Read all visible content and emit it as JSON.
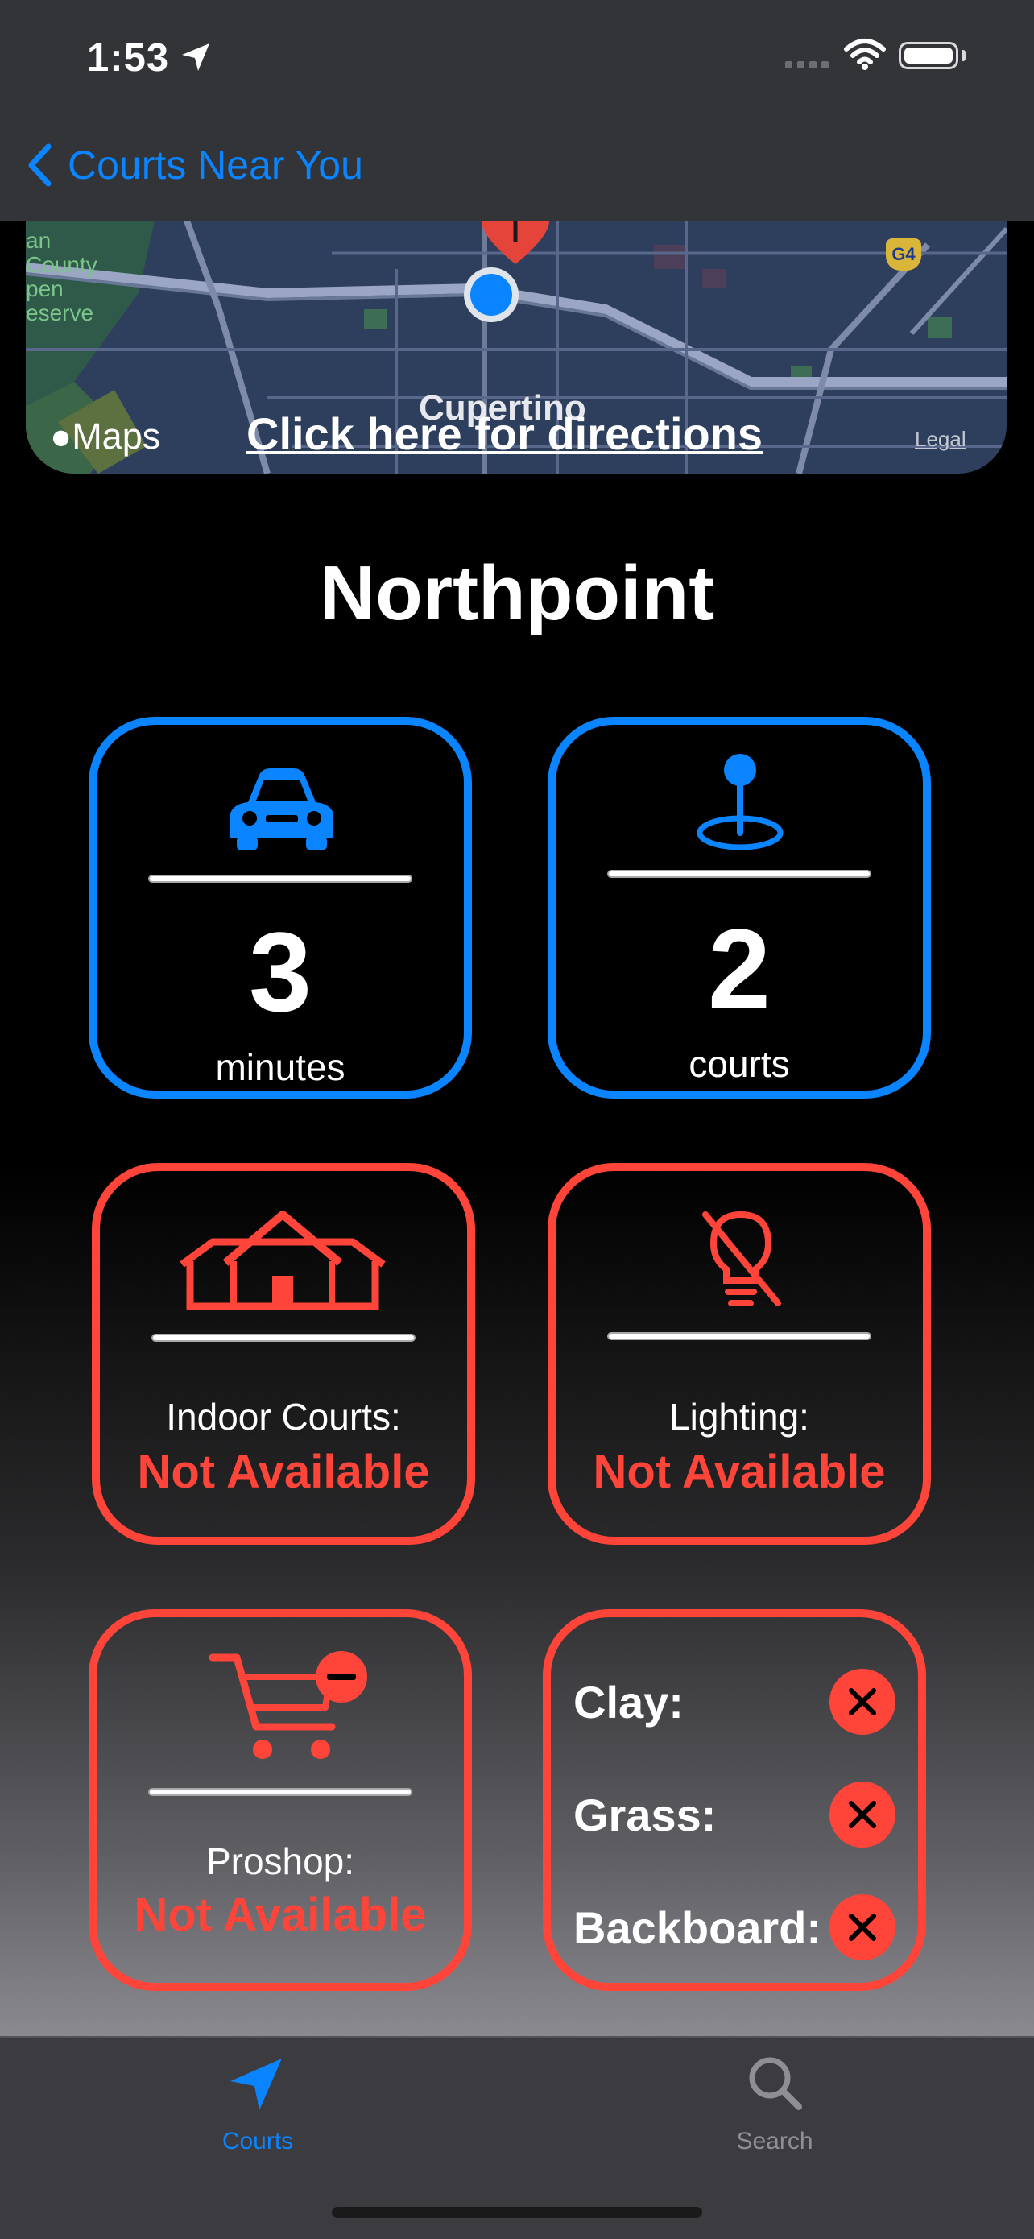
{
  "status": {
    "time": "1:53"
  },
  "nav": {
    "back_label": "Courts Near You"
  },
  "map": {
    "brand_label": "Maps",
    "city_label": "Cupertino",
    "directions_label": "Click here for directions",
    "legal_label": "Legal",
    "highway_label": "G4",
    "left_edge_label_lines": [
      "an",
      "County",
      "pen",
      "eserve"
    ]
  },
  "court": {
    "name": "Northpoint"
  },
  "stats": {
    "drive_time": {
      "value": "3",
      "unit": "minutes"
    },
    "court_count": {
      "value": "2",
      "unit": "courts"
    }
  },
  "features": {
    "indoor": {
      "label": "Indoor Courts:",
      "status": "Not Available"
    },
    "lighting": {
      "label": "Lighting:",
      "status": "Not Available"
    },
    "proshop": {
      "label": "Proshop:",
      "status": "Not Available"
    }
  },
  "surfaces": [
    {
      "label": "Clay:",
      "available": false
    },
    {
      "label": "Grass:",
      "available": false
    },
    {
      "label": "Backboard:",
      "available": false
    }
  ],
  "tabs": [
    {
      "label": "Courts",
      "icon": "location-arrow-icon",
      "selected": true
    },
    {
      "label": "Search",
      "icon": "magnifier-icon",
      "selected": false
    }
  ],
  "colors": {
    "accent": "#0a84ff",
    "unavailable": "#ff453a",
    "tab_inactive": "#8e8e93"
  }
}
